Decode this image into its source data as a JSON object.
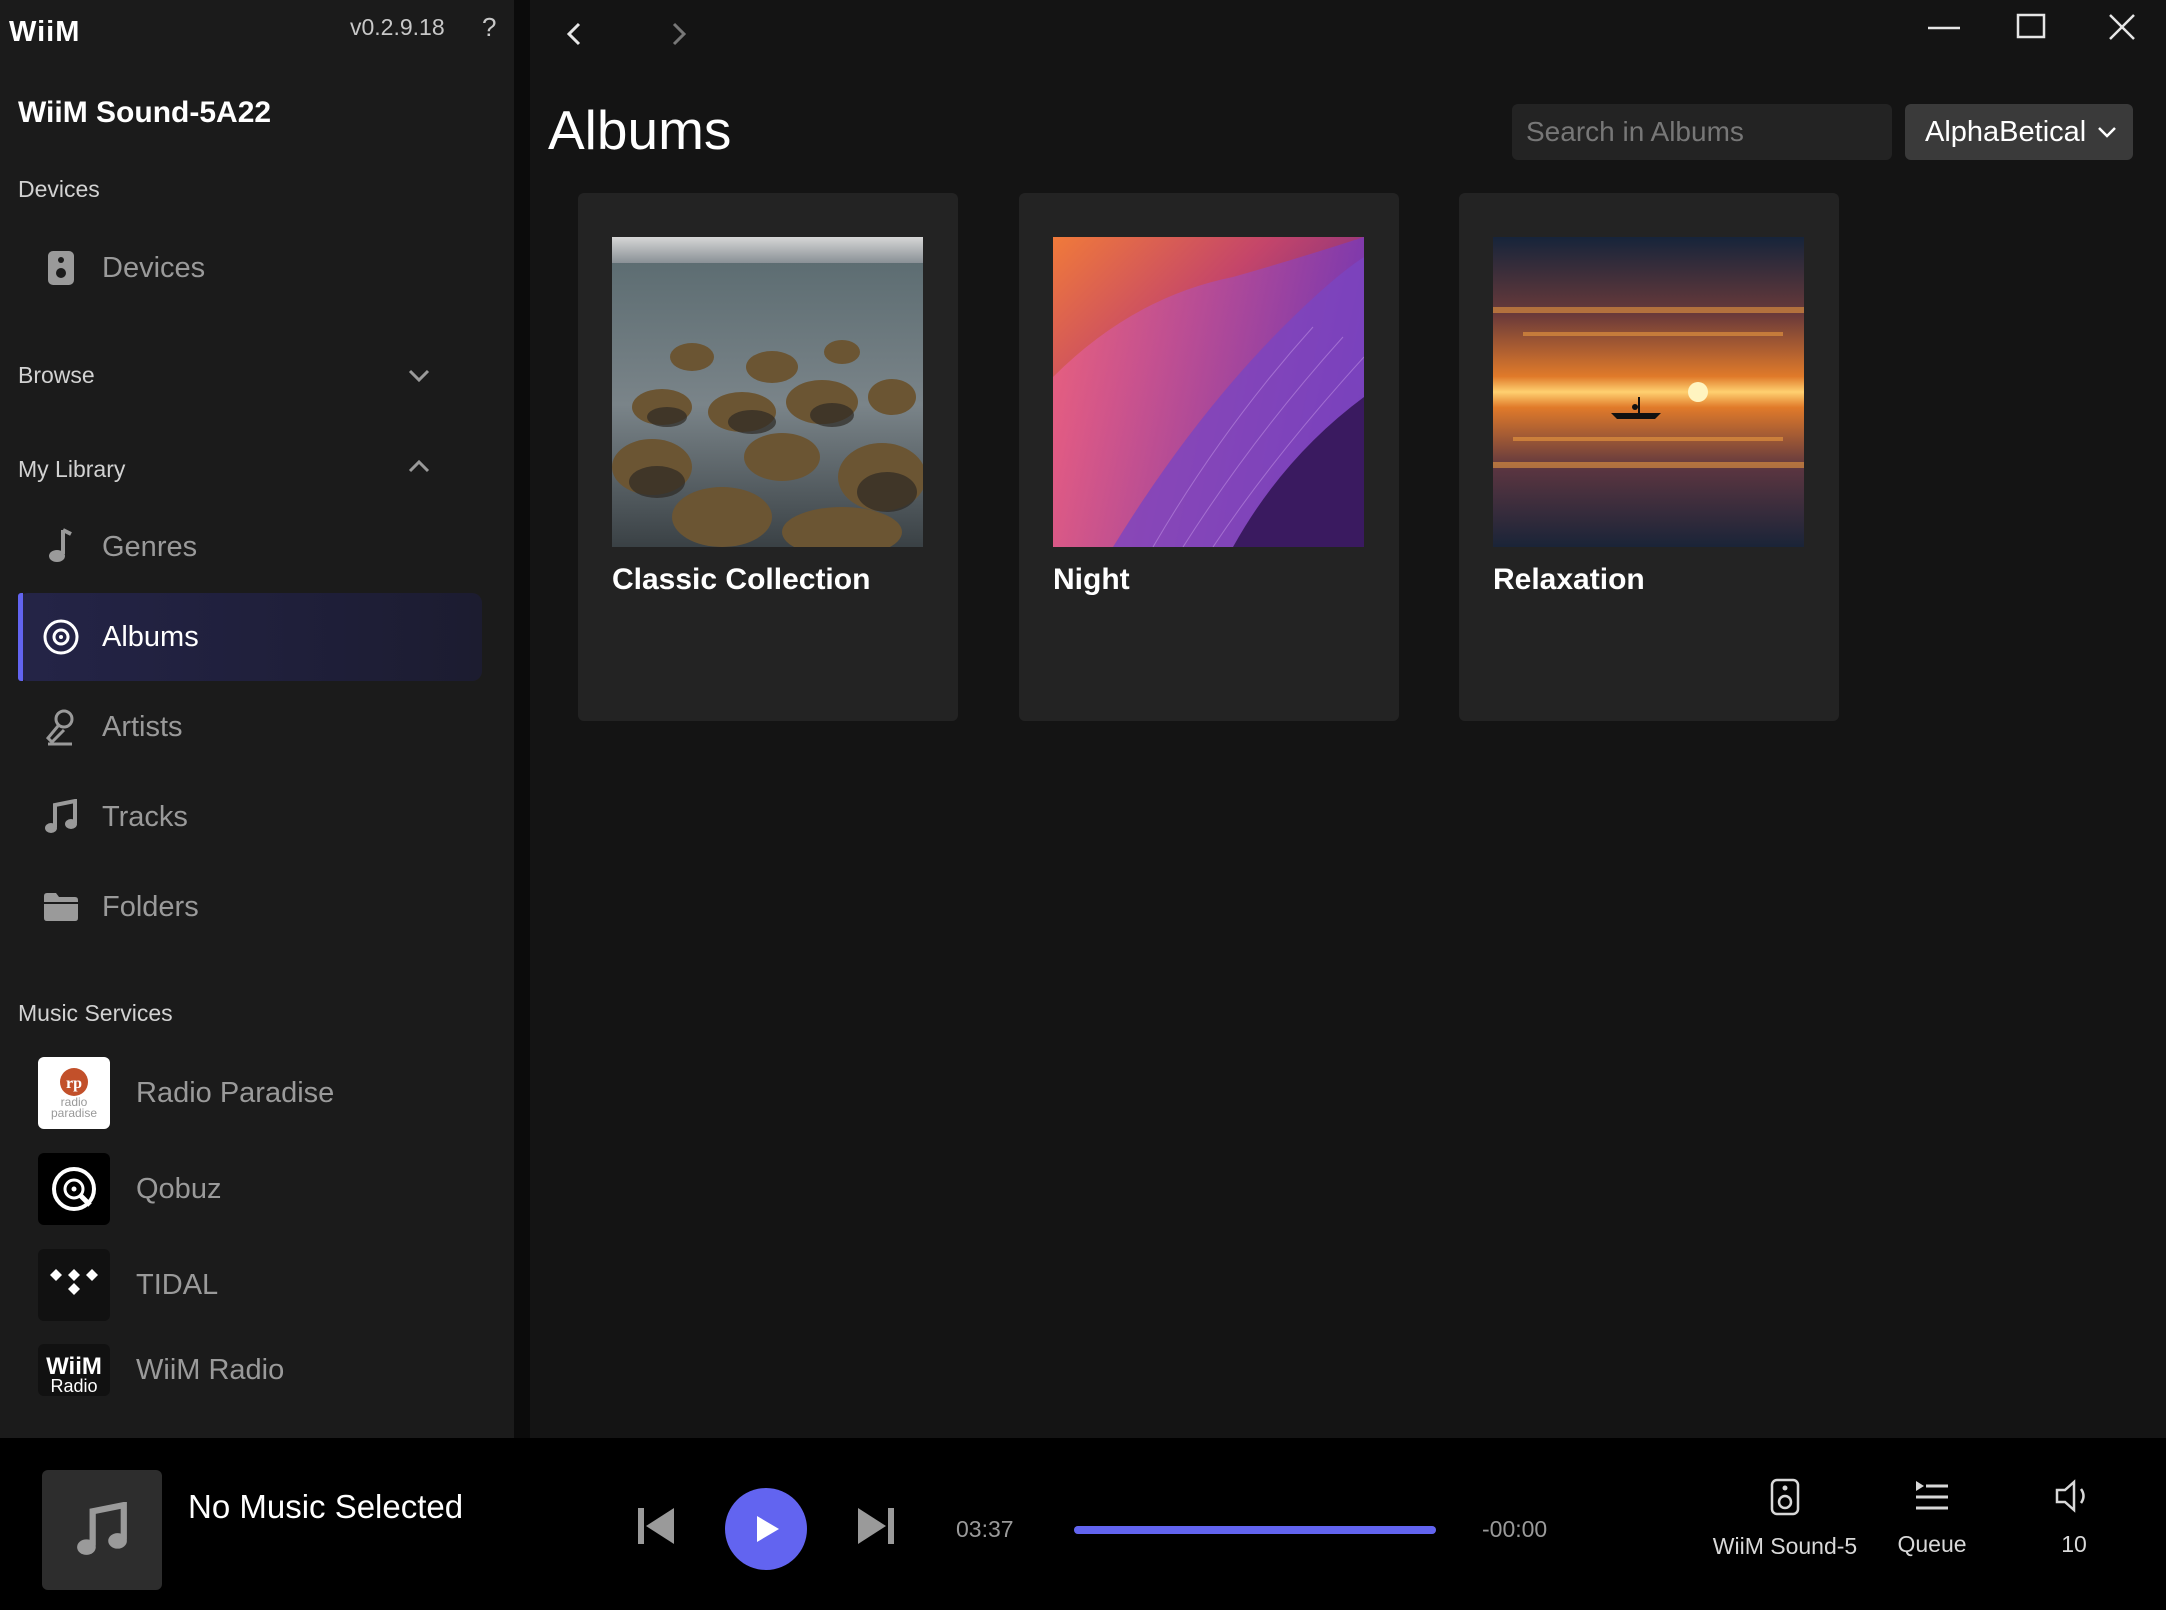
{
  "app": {
    "logo": "WiiM",
    "version": "v0.2.9.18",
    "help": "?"
  },
  "sidebar": {
    "device_title": "WiiM Sound-5A22",
    "devices_section": "Devices",
    "devices_item": "Devices",
    "browse_section": "Browse",
    "library_section": "My Library",
    "library_items": [
      {
        "label": "Genres",
        "icon": "music-note-icon"
      },
      {
        "label": "Albums",
        "icon": "album-disc-icon",
        "active": true
      },
      {
        "label": "Artists",
        "icon": "artist-icon"
      },
      {
        "label": "Tracks",
        "icon": "double-note-icon"
      },
      {
        "label": "Folders",
        "icon": "folder-icon"
      }
    ],
    "services_section": "Music Services",
    "services": [
      {
        "label": "Radio Paradise",
        "logo_text": "radio paradise",
        "logo_mark": "rp"
      },
      {
        "label": "Qobuz"
      },
      {
        "label": "TIDAL"
      },
      {
        "label": "WiiM Radio",
        "logo_text": "WiiM",
        "logo_sub": "Radio"
      }
    ]
  },
  "main": {
    "title": "Albums",
    "search_placeholder": "Search in Albums",
    "sort_value": "AlphaBetical",
    "albums": [
      {
        "name": "Classic Collection"
      },
      {
        "name": "Night"
      },
      {
        "name": "Relaxation"
      }
    ]
  },
  "player": {
    "now_playing": "No Music Selected",
    "elapsed": "03:37",
    "remaining": "-00:00",
    "progress": 1.0,
    "device": "WiiM Sound-5",
    "queue": "Queue",
    "volume": "10"
  },
  "colors": {
    "accent": "#6264f0",
    "sidebar_bg": "#1b1b1b",
    "main_bg": "#141414",
    "card_bg": "#232323"
  }
}
